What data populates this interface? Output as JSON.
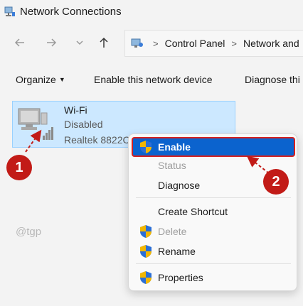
{
  "window": {
    "title": "Network Connections"
  },
  "nav": {
    "back_icon": "back-arrow-icon",
    "forward_icon": "forward-arrow-icon",
    "up_icon": "up-arrow-icon",
    "breadcrumbs": [
      "Control Panel",
      "Network and"
    ]
  },
  "toolbar": {
    "organize": "Organize",
    "enable": "Enable this network device",
    "diagnose": "Diagnose thi"
  },
  "connection": {
    "name": "Wi-Fi",
    "status": "Disabled",
    "adapter": "Realtek 8822C"
  },
  "context_menu": {
    "enable": "Enable",
    "status": "Status",
    "diagnose": "Diagnose",
    "create_shortcut": "Create Shortcut",
    "delete": "Delete",
    "rename": "Rename",
    "properties": "Properties"
  },
  "callouts": {
    "one": "1",
    "two": "2"
  },
  "watermark": "@tgp",
  "colors": {
    "selection": "#cce8ff",
    "highlight": "#0b63ce",
    "callout": "#c21b17"
  }
}
